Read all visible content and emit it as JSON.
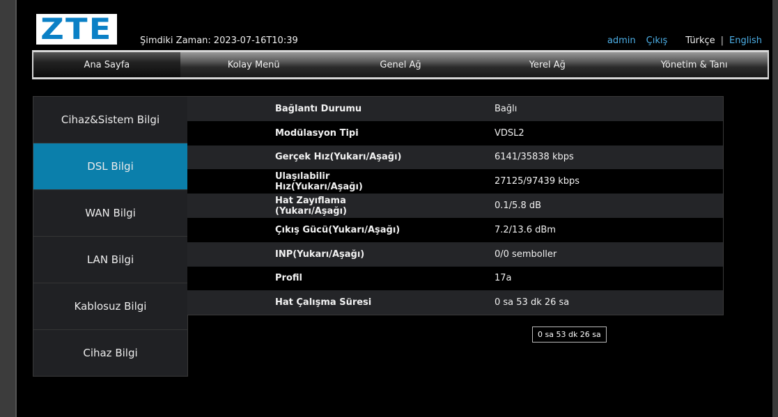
{
  "brand": "ZTE",
  "header": {
    "time_label": "Şimdiki Zaman:",
    "time_value": "2023-07-16T10:39",
    "user": "admin",
    "logout": "Çıkış",
    "lang_tr": "Türkçe",
    "lang_sep": "|",
    "lang_en": "English"
  },
  "nav": {
    "items": [
      {
        "label": "Ana Sayfa"
      },
      {
        "label": "Kolay Menü"
      },
      {
        "label": "Genel Ağ"
      },
      {
        "label": "Yerel Ağ"
      },
      {
        "label": "Yönetim & Tanı"
      }
    ],
    "active": "Ana Sayfa"
  },
  "sidebar": {
    "items": [
      {
        "label": "Cihaz&Sistem Bilgi"
      },
      {
        "label": "DSL Bilgi"
      },
      {
        "label": "WAN Bilgi"
      },
      {
        "label": "LAN Bilgi"
      },
      {
        "label": "Kablosuz Bilgi"
      },
      {
        "label": "Cihaz Bilgi"
      }
    ],
    "active": "DSL Bilgi",
    "active_color": "#0b7fab"
  },
  "dsl": {
    "rows": [
      {
        "label": "Bağlantı Durumu",
        "value": "Bağlı"
      },
      {
        "label": "Modülasyon Tipi",
        "value": "VDSL2"
      },
      {
        "label": "Gerçek Hız(Yukarı/Aşağı)",
        "value": "6141/35838 kbps"
      },
      {
        "label": "Ulaşılabilir Hız(Yukarı/Aşağı)",
        "value": "27125/97439 kbps"
      },
      {
        "label": "Hat Zayıflama (Yukarı/Aşağı)",
        "value": "0.1/5.8 dB"
      },
      {
        "label": "Çıkış Gücü(Yukarı/Aşağı)",
        "value": "7.2/13.6 dBm"
      },
      {
        "label": "INP(Yukarı/Aşağı)",
        "value": "0/0 semboller"
      },
      {
        "label": "Profil",
        "value": "17a"
      },
      {
        "label": "Hat Çalışma Süresi",
        "value": "0 sa 53 dk 26 sa"
      }
    ]
  },
  "tooltip": "0 sa 53 dk 26 sa",
  "colors": {
    "link": "#4db0e8",
    "logo": "#0a80c6",
    "accent": "#0b7fab"
  }
}
